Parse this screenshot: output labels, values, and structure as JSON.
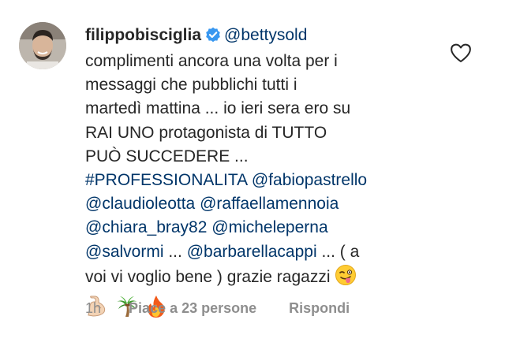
{
  "comment": {
    "username": "filippobisciglia",
    "reply_to": "@bettysold",
    "line_1_text": "complimenti ancora una volta per i",
    "line_2_text": "messaggi che pubblichi tutti i",
    "line_3_text": "martedì mattina ... io ieri sera ero su",
    "line_4_text": "RAI UNO protagonista di TUTTO",
    "line_5_text": "PUÒ SUCCEDERE ...",
    "hashtag": "#PROFESSIONALITA",
    "mention_1": "@fabiopastrello",
    "mention_2": "@claudioleotta",
    "mention_3": "@raffaellamennoia",
    "mention_4": "@chiara_bray82",
    "mention_5": "@micheleperna",
    "mention_6": "@salvormi",
    "sep_1": "...",
    "mention_7": "@barbarellacappi",
    "line_9_tail": "... ( a",
    "line_10_text": "voi vi voglio bene ) grazie ragazzi",
    "emoji_winking": "winking-tongue-emoji",
    "emojis": [
      "flexed-biceps-emoji",
      "palm-tree-emoji",
      "fire-emoji"
    ]
  },
  "footer": {
    "time": "1h",
    "likes": "Piace a 23 persone",
    "reply": "Rispondi"
  },
  "colors": {
    "text": "#262626",
    "link": "#003569",
    "meta": "#8e8e8e",
    "verified": "#3897f0"
  }
}
